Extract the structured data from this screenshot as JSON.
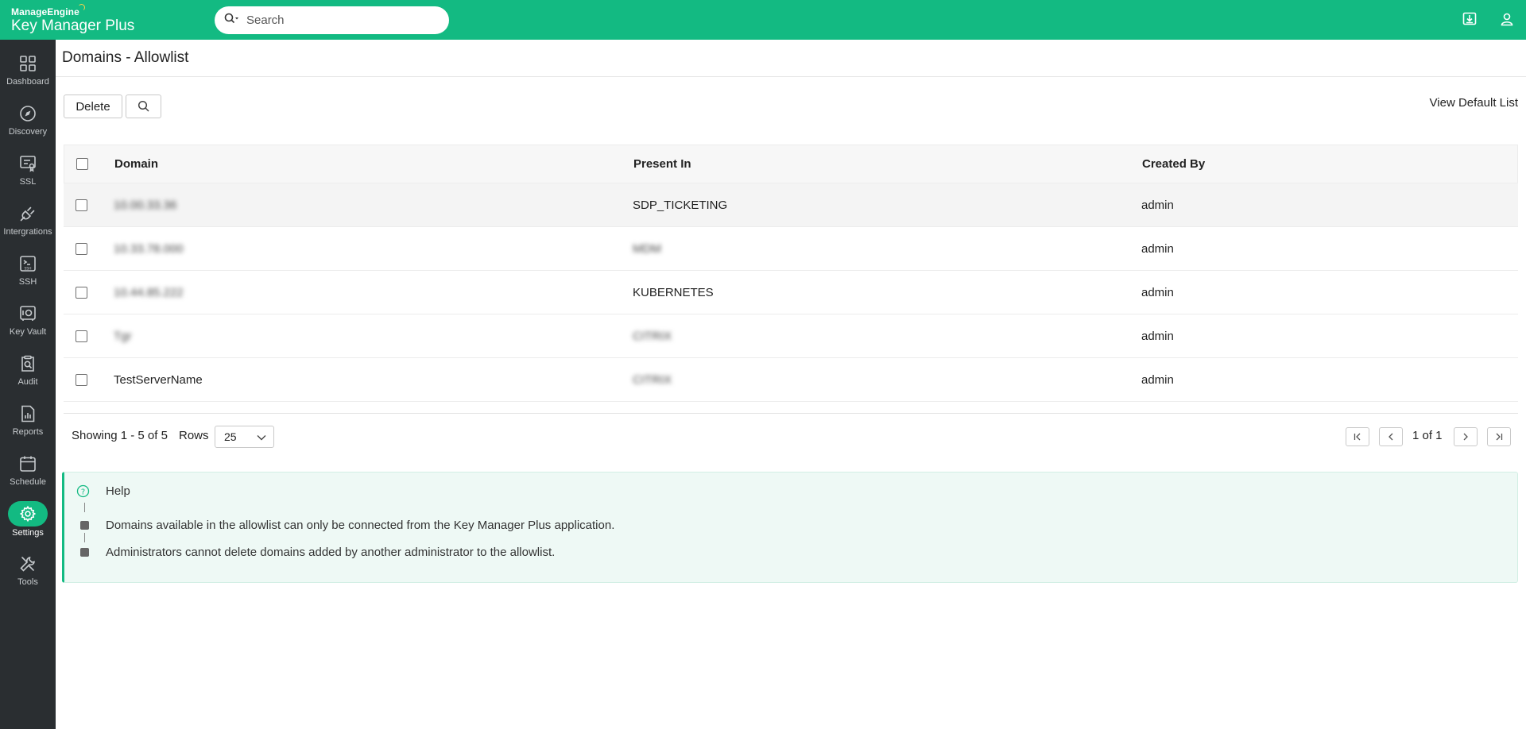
{
  "app": {
    "vendor": "ManageEngine",
    "product_main": "Key Manager",
    "product_suffix": "Plus",
    "brand_color": "#13ba82",
    "sidebar_color": "#2a2e31"
  },
  "search": {
    "placeholder": "Search"
  },
  "topbar_icons": [
    "download-icon",
    "user-icon"
  ],
  "sidebar": {
    "items": [
      {
        "label": "Dashboard",
        "icon": "dashboard-icon"
      },
      {
        "label": "Discovery",
        "icon": "compass-icon"
      },
      {
        "label": "SSL",
        "icon": "certificate-icon"
      },
      {
        "label": "Intergrations",
        "icon": "plug-icon"
      },
      {
        "label": "SSH",
        "icon": "ssh-icon"
      },
      {
        "label": "Key Vault",
        "icon": "vault-icon"
      },
      {
        "label": "Audit",
        "icon": "audit-icon"
      },
      {
        "label": "Reports",
        "icon": "reports-icon"
      },
      {
        "label": "Schedule",
        "icon": "calendar-icon"
      },
      {
        "label": "Settings",
        "icon": "gear-icon",
        "active": true
      },
      {
        "label": "Tools",
        "icon": "tools-icon"
      }
    ]
  },
  "page": {
    "title": "Domains - Allowlist"
  },
  "toolbar": {
    "delete_label": "Delete",
    "view_default_label": "View Default List"
  },
  "table": {
    "columns": [
      "Domain",
      "Present In",
      "Created By"
    ],
    "rows": [
      {
        "domain": "10.00.33.36",
        "present_in": "SDP_TICKETING",
        "created_by": "admin"
      },
      {
        "domain": "10.33.78.000",
        "present_in": "MDM",
        "created_by": "admin"
      },
      {
        "domain": "10.44.85.222",
        "present_in": "KUBERNETES",
        "created_by": "admin"
      },
      {
        "domain": "Tgr",
        "present_in": "CITRIX",
        "created_by": "admin"
      },
      {
        "domain": "TestServerName",
        "present_in": "CITRIX",
        "created_by": "admin"
      }
    ]
  },
  "pagination": {
    "showing": "Showing 1 - 5 of 5",
    "rows_label": "Rows",
    "rows_value": "25",
    "page_text": "1 of 1"
  },
  "help": {
    "title": "Help",
    "lines": [
      "Domains available in the allowlist can only be connected from the Key Manager Plus application.",
      "Administrators cannot delete domains added by another administrator to the allowlist."
    ]
  }
}
